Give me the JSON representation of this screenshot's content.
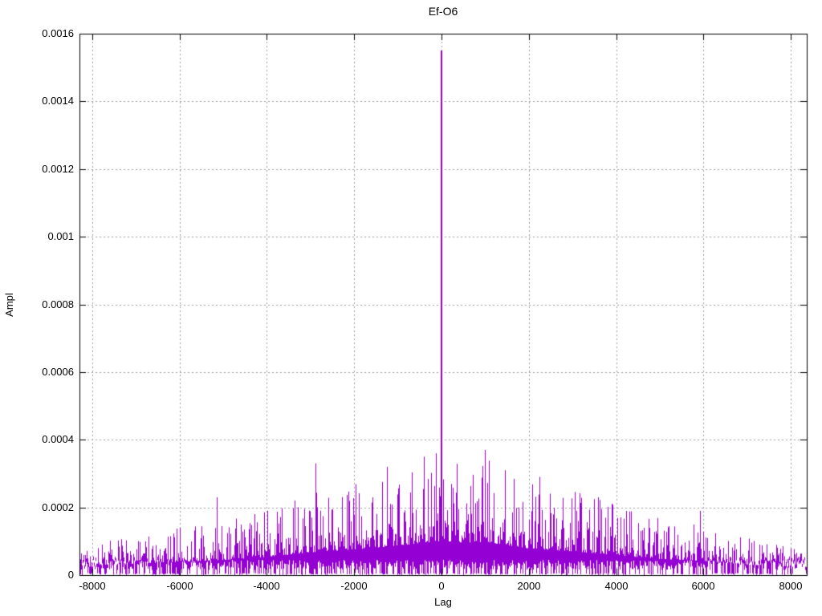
{
  "window": {
    "background": "#ffffff",
    "text_color": "#000000",
    "grid_color": "#9e9e9e",
    "border_color": "#000000"
  },
  "chart_data": {
    "type": "line",
    "title": "Ef-O6",
    "xlabel": "Lag",
    "ylabel": "Ampl",
    "xlim": [
      -8290,
      8365
    ],
    "ylim": [
      0,
      0.0016
    ],
    "xticks": [
      -8000,
      -6000,
      -4000,
      -2000,
      0,
      2000,
      4000,
      6000,
      8000
    ],
    "xtick_labels": [
      "-8000",
      "-6000",
      "-4000",
      "-2000",
      "0",
      "2000",
      "4000",
      "6000",
      "8000"
    ],
    "yticks": [
      0,
      0.0002,
      0.0004,
      0.0006,
      0.0008,
      0.001,
      0.0012,
      0.0014,
      0.0016
    ],
    "ytick_labels": [
      "0",
      "0.0002",
      "0.0004",
      "0.0006",
      "0.0008",
      "0.001",
      "0.0012",
      "0.0014",
      "0.0016"
    ],
    "grid": true,
    "legend": "none",
    "series_color": "#9400d3",
    "main_peak": {
      "lag": 0,
      "value": 0.00155
    },
    "notable_spikes": [
      [
        -5150,
        0.00023
      ],
      [
        -2890,
        0.00033
      ],
      [
        -1250,
        0.00032
      ],
      [
        -400,
        0.00035
      ],
      [
        -120,
        0.00036
      ],
      [
        990,
        0.00037
      ],
      [
        1450,
        0.00031
      ],
      [
        2240,
        0.00029
      ],
      [
        3590,
        0.00023
      ],
      [
        5920,
        0.00019
      ]
    ],
    "noise_envelope": [
      [
        -8290,
        8e-05
      ],
      [
        -8000,
        9e-05
      ],
      [
        -7000,
        0.00012
      ],
      [
        -6000,
        0.00014
      ],
      [
        -5000,
        0.00016
      ],
      [
        -4000,
        0.00019
      ],
      [
        -3000,
        0.00024
      ],
      [
        -2000,
        0.00027
      ],
      [
        -1000,
        0.00031
      ],
      [
        -400,
        0.00034
      ],
      [
        0,
        0.00036
      ],
      [
        400,
        0.00034
      ],
      [
        1000,
        0.00035
      ],
      [
        2000,
        0.00028
      ],
      [
        3000,
        0.00025
      ],
      [
        4000,
        0.00021
      ],
      [
        5000,
        0.00017
      ],
      [
        6000,
        0.00015
      ],
      [
        7000,
        0.00011
      ],
      [
        8000,
        9e-05
      ],
      [
        8365,
        8e-05
      ]
    ],
    "noise": {
      "seed": 1337,
      "floor_min": 0,
      "band_bottom_typical": 2e-05,
      "band_top_fraction_of_envelope": 0.3
    }
  }
}
